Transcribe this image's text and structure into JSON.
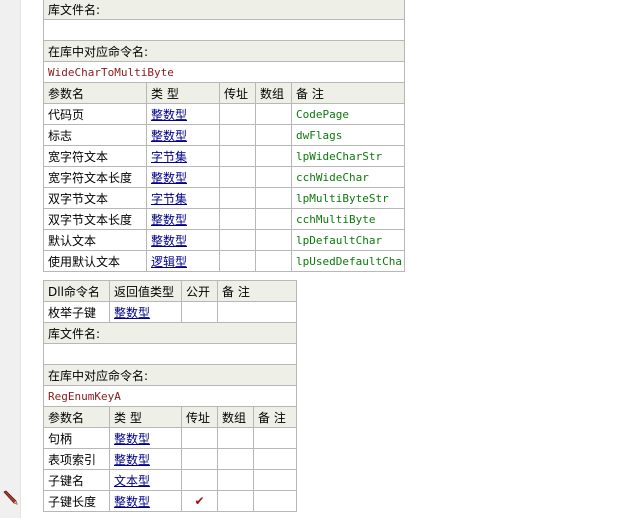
{
  "labels": {
    "lib_file": "库文件名:",
    "lib_cmd": "在库中对应命令名:",
    "param_name": "参数名",
    "type": "类 型",
    "by_addr": "传址",
    "array": "数组",
    "remark": "备 注",
    "dll_cmd": "Dll命令名",
    "return_type": "返回值类型",
    "public": "公开"
  },
  "cmd1": {
    "lib_file_value": "",
    "lib_cmd_value": "WideCharToMultiByte",
    "params": [
      {
        "name": "代码页",
        "type": "整数型",
        "byaddr": "",
        "array": "",
        "remark": "CodePage"
      },
      {
        "name": "标志",
        "type": "整数型",
        "byaddr": "",
        "array": "",
        "remark": "dwFlags"
      },
      {
        "name": "宽字符文本",
        "type": "字节集",
        "byaddr": "",
        "array": "",
        "remark": "lpWideCharStr"
      },
      {
        "name": "宽字符文本长度",
        "type": "整数型",
        "byaddr": "",
        "array": "",
        "remark": "cchWideChar"
      },
      {
        "name": "双字节文本",
        "type": "字节集",
        "byaddr": "",
        "array": "",
        "remark": "lpMultiByteStr"
      },
      {
        "name": "双字节文本长度",
        "type": "整数型",
        "byaddr": "",
        "array": "",
        "remark": "cchMultiByte"
      },
      {
        "name": "默认文本",
        "type": "整数型",
        "byaddr": "",
        "array": "",
        "remark": "lpDefaultChar"
      },
      {
        "name": "使用默认文本",
        "type": "逻辑型",
        "byaddr": "",
        "array": "",
        "remark": "lpUsedDefaultChar"
      }
    ]
  },
  "cmd2": {
    "name": "枚举子键",
    "return_type": "整数型",
    "public": "",
    "remark": "",
    "lib_file_value": "",
    "lib_cmd_value": "RegEnumKeyA",
    "params": [
      {
        "name": "句柄",
        "type": "整数型",
        "byaddr": "",
        "array": "",
        "remark": ""
      },
      {
        "name": "表项索引",
        "type": "整数型",
        "byaddr": "",
        "array": "",
        "remark": ""
      },
      {
        "name": "子键名",
        "type": "文本型",
        "byaddr": "",
        "array": "",
        "remark": ""
      },
      {
        "name": "子键长度",
        "type": "整数型",
        "byaddr": "✔",
        "array": "",
        "remark": ""
      }
    ]
  },
  "icons": {
    "gutter_marker": "pencil-icon",
    "byaddr_check": "checkmark-icon"
  },
  "colors": {
    "header_bg": "#eef0e8",
    "border": "#b7b7b7",
    "type_link": "#000088",
    "remark_text": "#0b7a0b",
    "lib_cmd_text": "#8b1a1a",
    "checkmark": "#a01010"
  }
}
